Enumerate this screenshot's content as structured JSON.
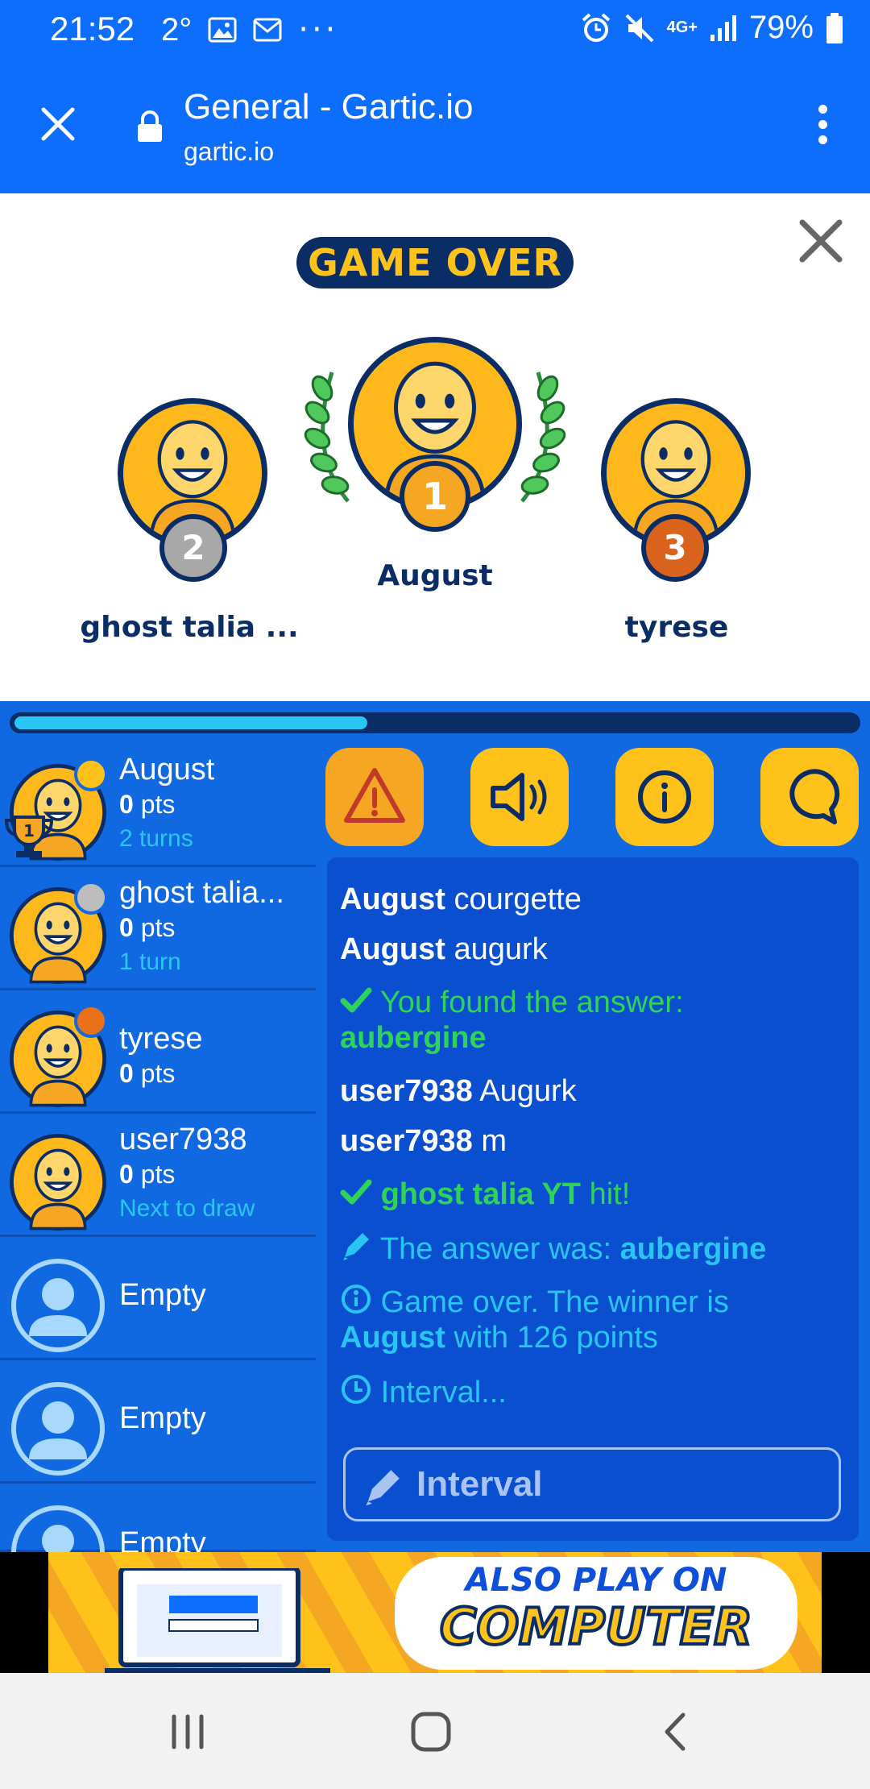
{
  "status_bar": {
    "time": "21:52",
    "temp": "2°",
    "battery": "79%",
    "network": "4G+"
  },
  "browser": {
    "title": "General - Gartic.io",
    "url": "gartic.io"
  },
  "game_over": {
    "heading": "GAME OVER",
    "podium": [
      {
        "rank": "1",
        "name": "August"
      },
      {
        "rank": "2",
        "name": "ghost talia ..."
      },
      {
        "rank": "3",
        "name": "tyrese"
      }
    ]
  },
  "progress": {
    "fraction": 0.42
  },
  "players": [
    {
      "name": "August",
      "pts_value": "0",
      "pts_label": "pts",
      "sub": "2 turns",
      "dot": "#ffc21a",
      "trophy": "1"
    },
    {
      "name": "ghost talia...",
      "pts_value": "0",
      "pts_label": "pts",
      "sub": "1 turn",
      "dot": "#bdbdbd"
    },
    {
      "name": "tyrese",
      "pts_value": "0",
      "pts_label": "pts",
      "sub": "",
      "dot": "#e8711a"
    },
    {
      "name": "user7938",
      "pts_value": "0",
      "pts_label": "pts",
      "sub": "Next to draw"
    },
    {
      "name": "Empty"
    },
    {
      "name": "Empty"
    },
    {
      "name": "Empty"
    }
  ],
  "toolbar": [
    "warning-icon",
    "speaker-icon",
    "info-icon",
    "chat-icon"
  ],
  "chat": [
    {
      "user": "August",
      "text": "courgette"
    },
    {
      "user": "August",
      "text": "augurk"
    },
    {
      "text": "You found the answer:",
      "answer": "aubergine"
    },
    {
      "user": "user7938",
      "text": "Augurk"
    },
    {
      "user": "user7938",
      "text": "m"
    },
    {
      "user": "ghost talia YT",
      "text": "hit!"
    },
    {
      "text": "The answer was:",
      "answer": "aubergine"
    },
    {
      "text": "Game over. The winner is",
      "winner": "August",
      "tail": "with 126 points"
    },
    {
      "text": "Interval..."
    }
  ],
  "input": {
    "placeholder": "Interval"
  },
  "ad": {
    "line1": "ALSO PLAY ON",
    "line2": "COMPUTER"
  }
}
